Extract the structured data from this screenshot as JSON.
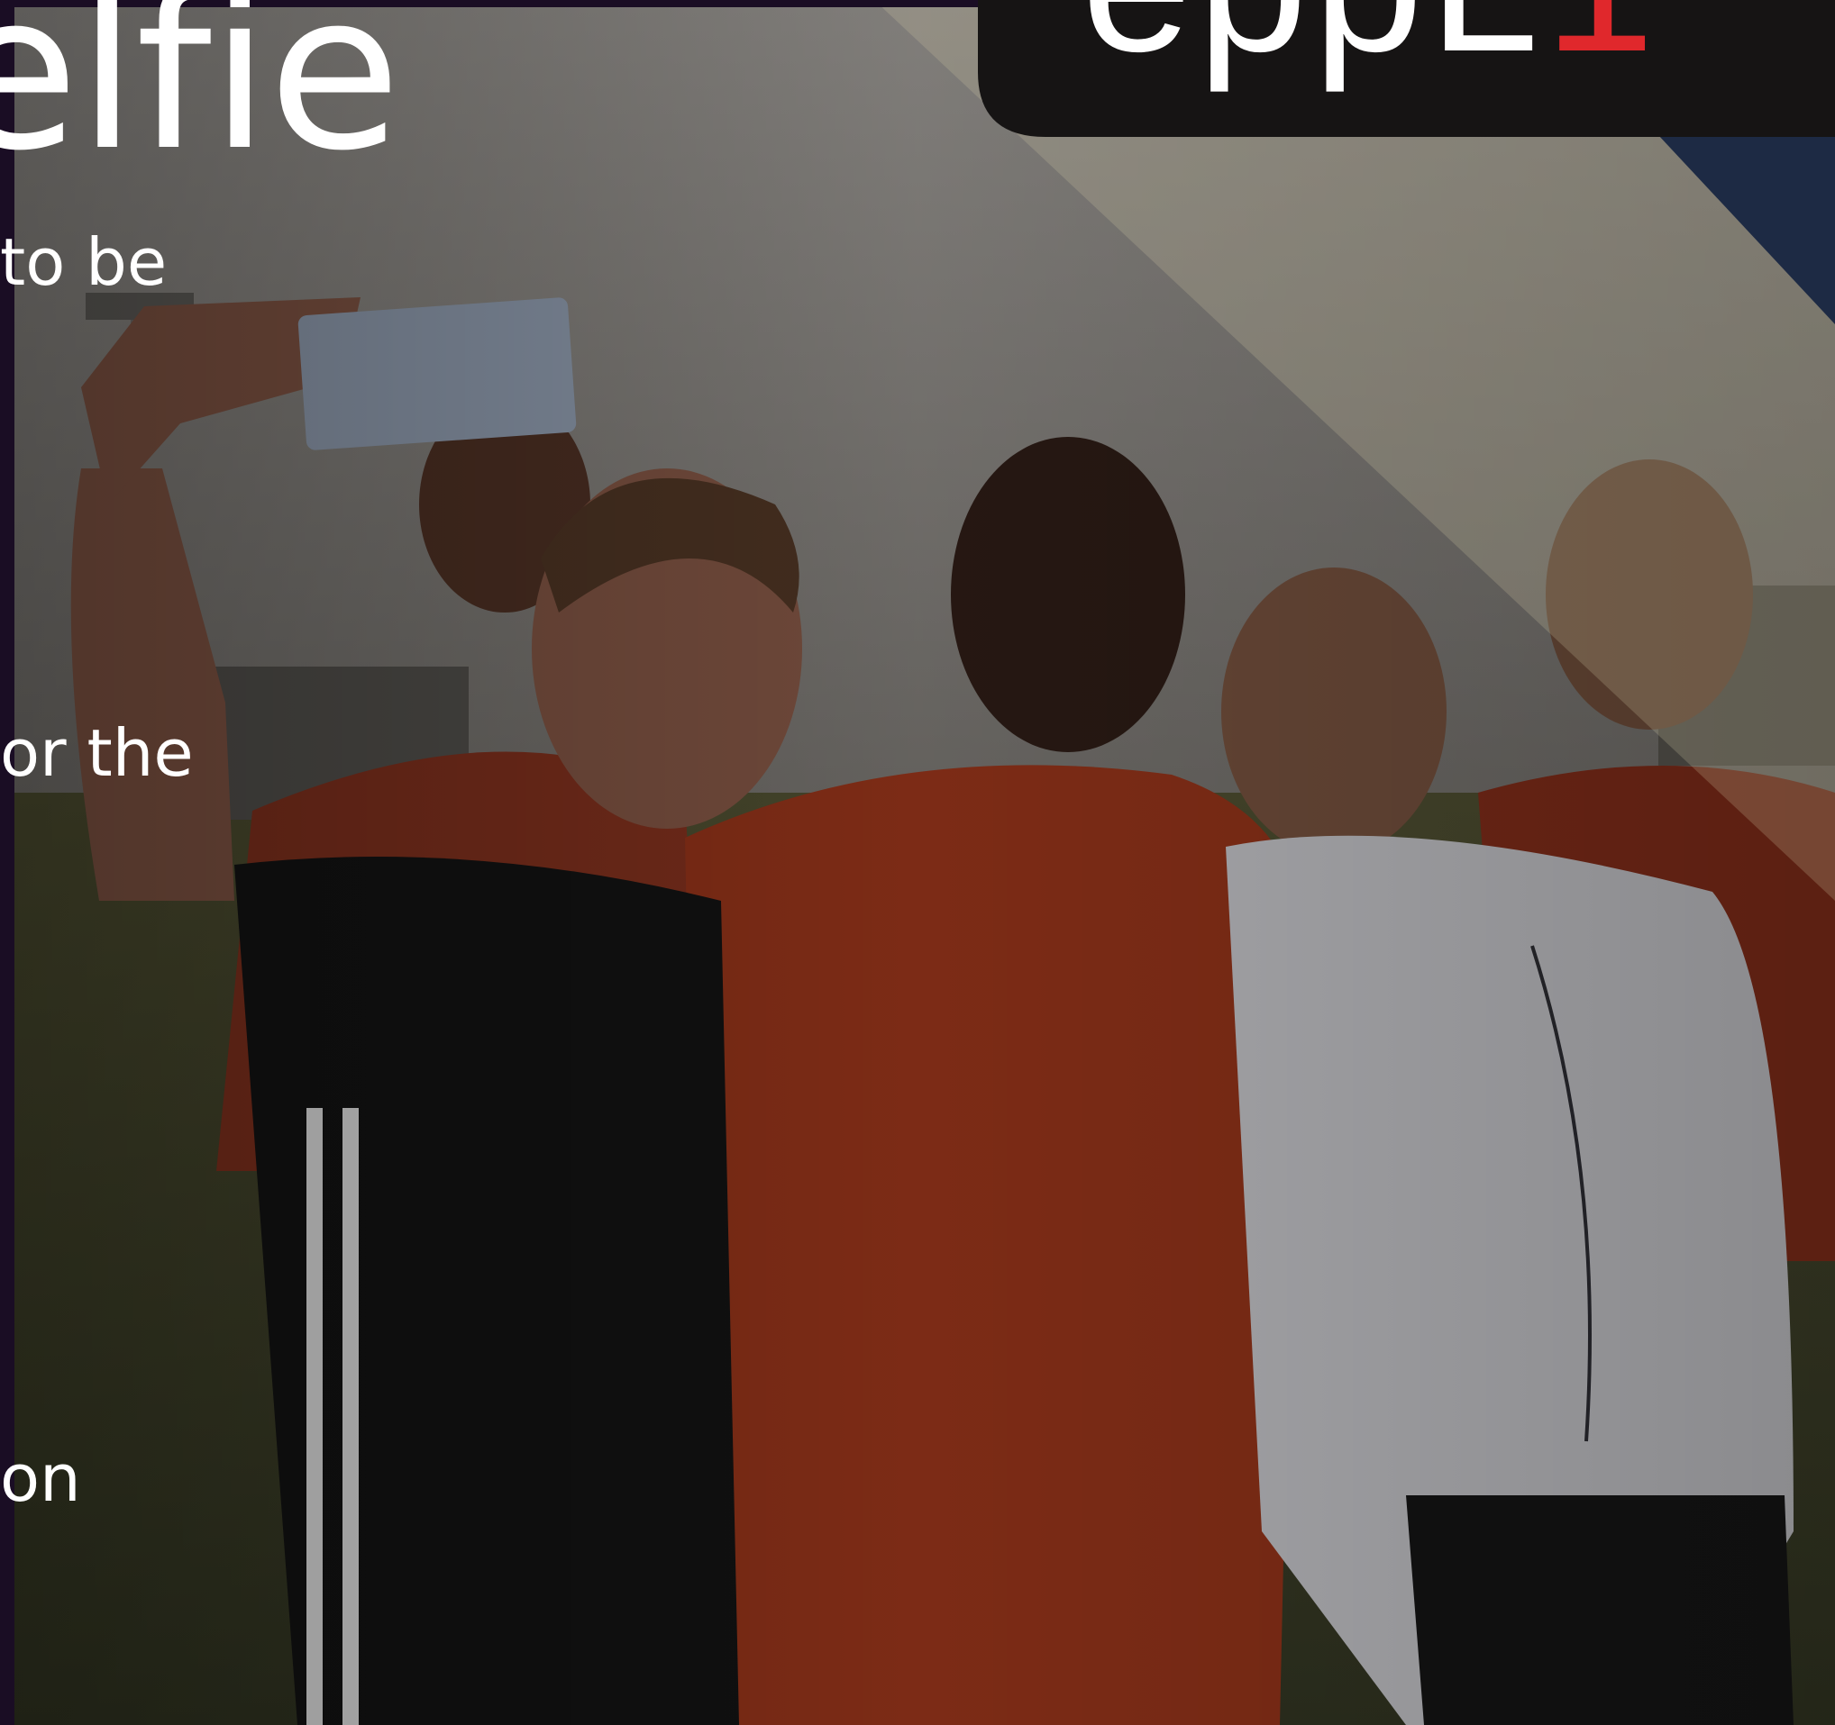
{
  "headline": "elfie",
  "text_fragments": [
    "to be",
    "or the",
    "on"
  ],
  "logo": {
    "text": "eppL",
    "accent": "1"
  },
  "colors": {
    "left_strip": "#1a0d24",
    "logo_box": "#161414",
    "navy_triangle": "#1d2a44",
    "logo_accent": "#e0282c"
  }
}
